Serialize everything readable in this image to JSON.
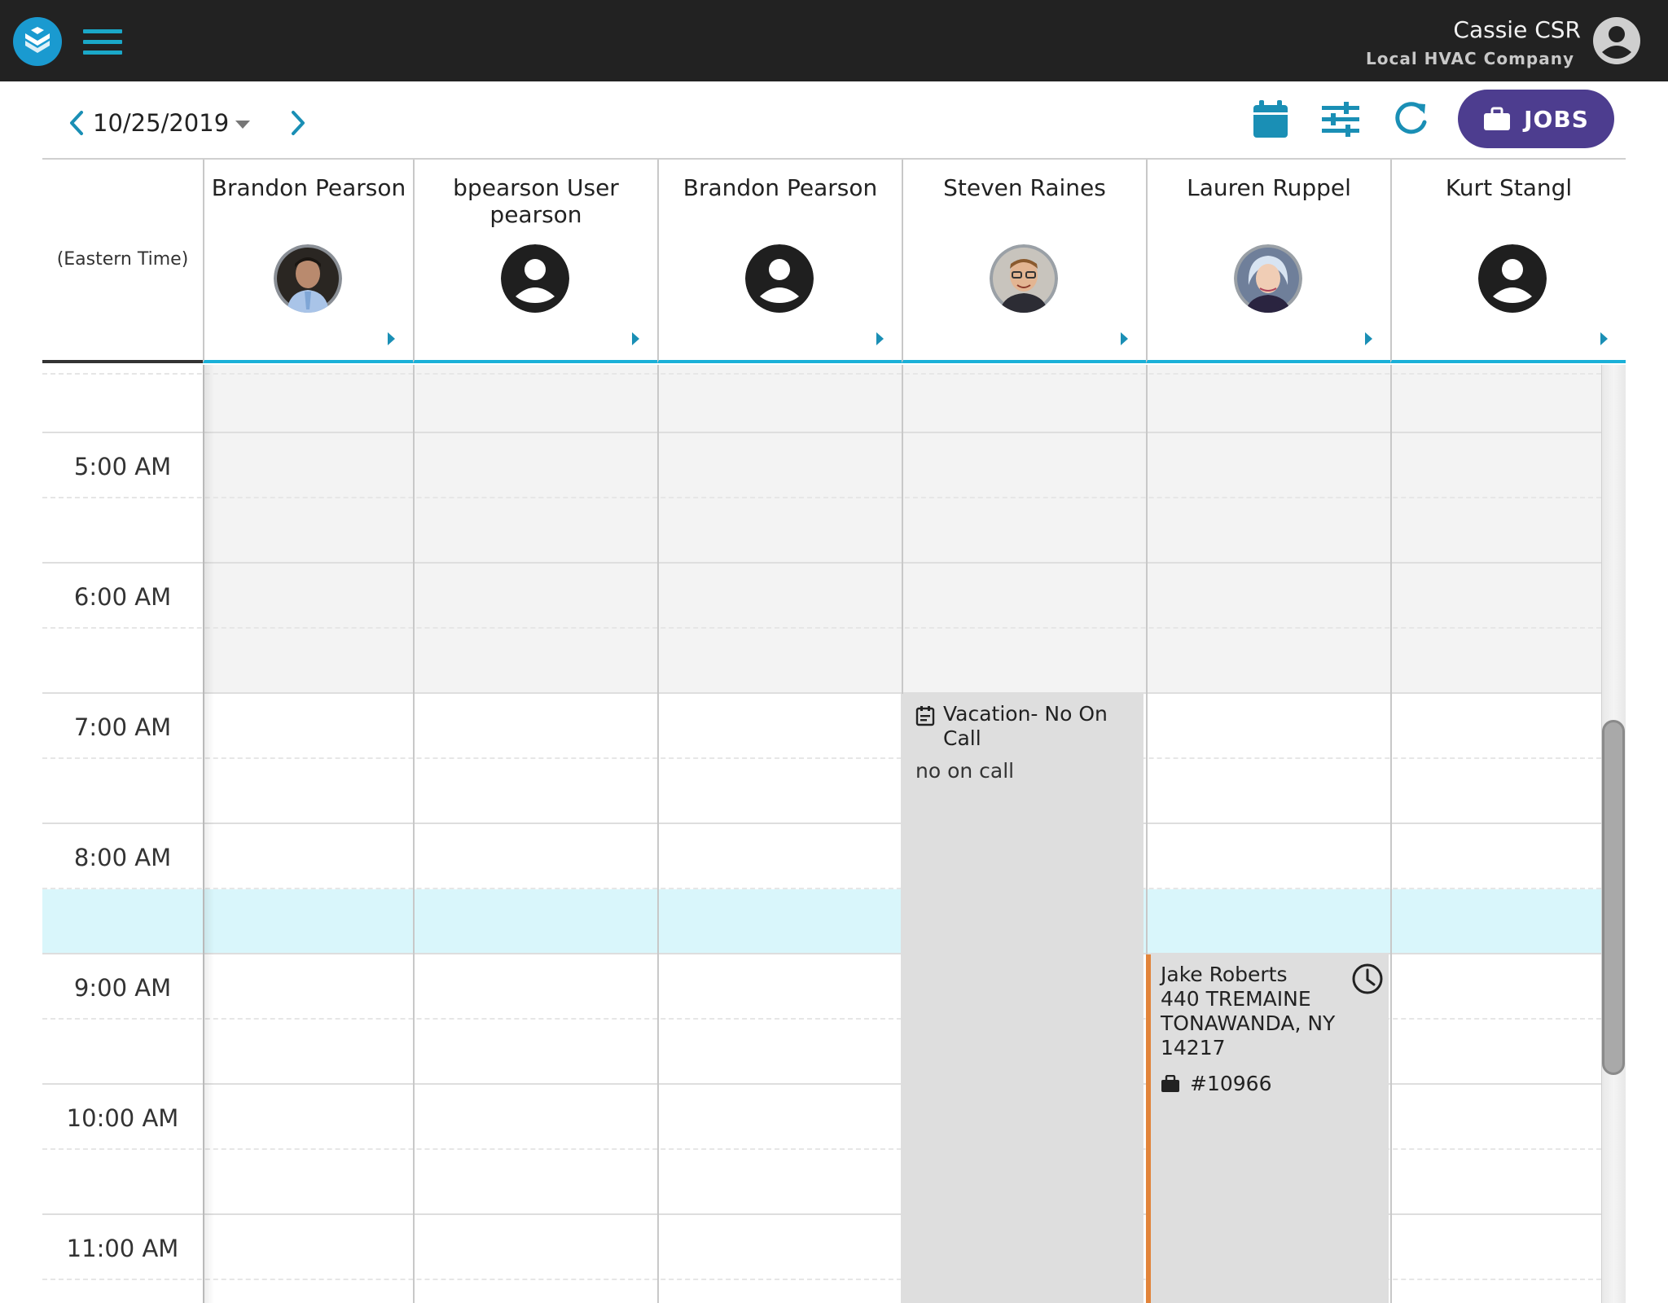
{
  "app": {
    "user_name": "Cassie CSR",
    "company": "Local HVAC Company",
    "brand_color": "#1a9ad0",
    "icons": [
      "app-logo-icon",
      "hamburger-menu-icon",
      "account-circle-icon"
    ]
  },
  "toolbar": {
    "date": "10/25/2019",
    "jobs_label": "JOBS",
    "jobs_button_color": "#4d3d8f",
    "icons": [
      "chevron-left-icon",
      "chevron-right-icon",
      "calendar-icon",
      "filter-sliders-icon",
      "refresh-icon",
      "briefcase-icon"
    ]
  },
  "schedule": {
    "timezone_label": "(Eastern Time)",
    "technicians": [
      {
        "name": "Brandon Pearson",
        "avatar": "photo"
      },
      {
        "name": "bpearson User pearson",
        "avatar": "default-user-icon"
      },
      {
        "name": "Brandon Pearson",
        "avatar": "default-user-icon"
      },
      {
        "name": "Steven Raines",
        "avatar": "photo"
      },
      {
        "name": "Lauren Ruppel",
        "avatar": "photo"
      },
      {
        "name": "Kurt Stangl",
        "avatar": "default-user-icon"
      }
    ],
    "time_slots": [
      "5:00 AM",
      "6:00 AM",
      "7:00 AM",
      "8:00 AM",
      "9:00 AM",
      "10:00 AM",
      "11:00 AM"
    ],
    "events": {
      "vacation": {
        "title": "Vacation- No On Call",
        "note": "no on call",
        "technician": "Steven Raines",
        "icon": "calendar-note-icon"
      },
      "job": {
        "customer": "Jake Roberts",
        "address_line1": "440 TREMAINE",
        "address_line2": "TONAWANDA, NY",
        "zip": "14217",
        "job_number": "#10966",
        "technician": "Lauren Ruppel",
        "status_color": "#e2843a",
        "icons": [
          "clock-icon",
          "briefcase-icon"
        ]
      }
    }
  }
}
